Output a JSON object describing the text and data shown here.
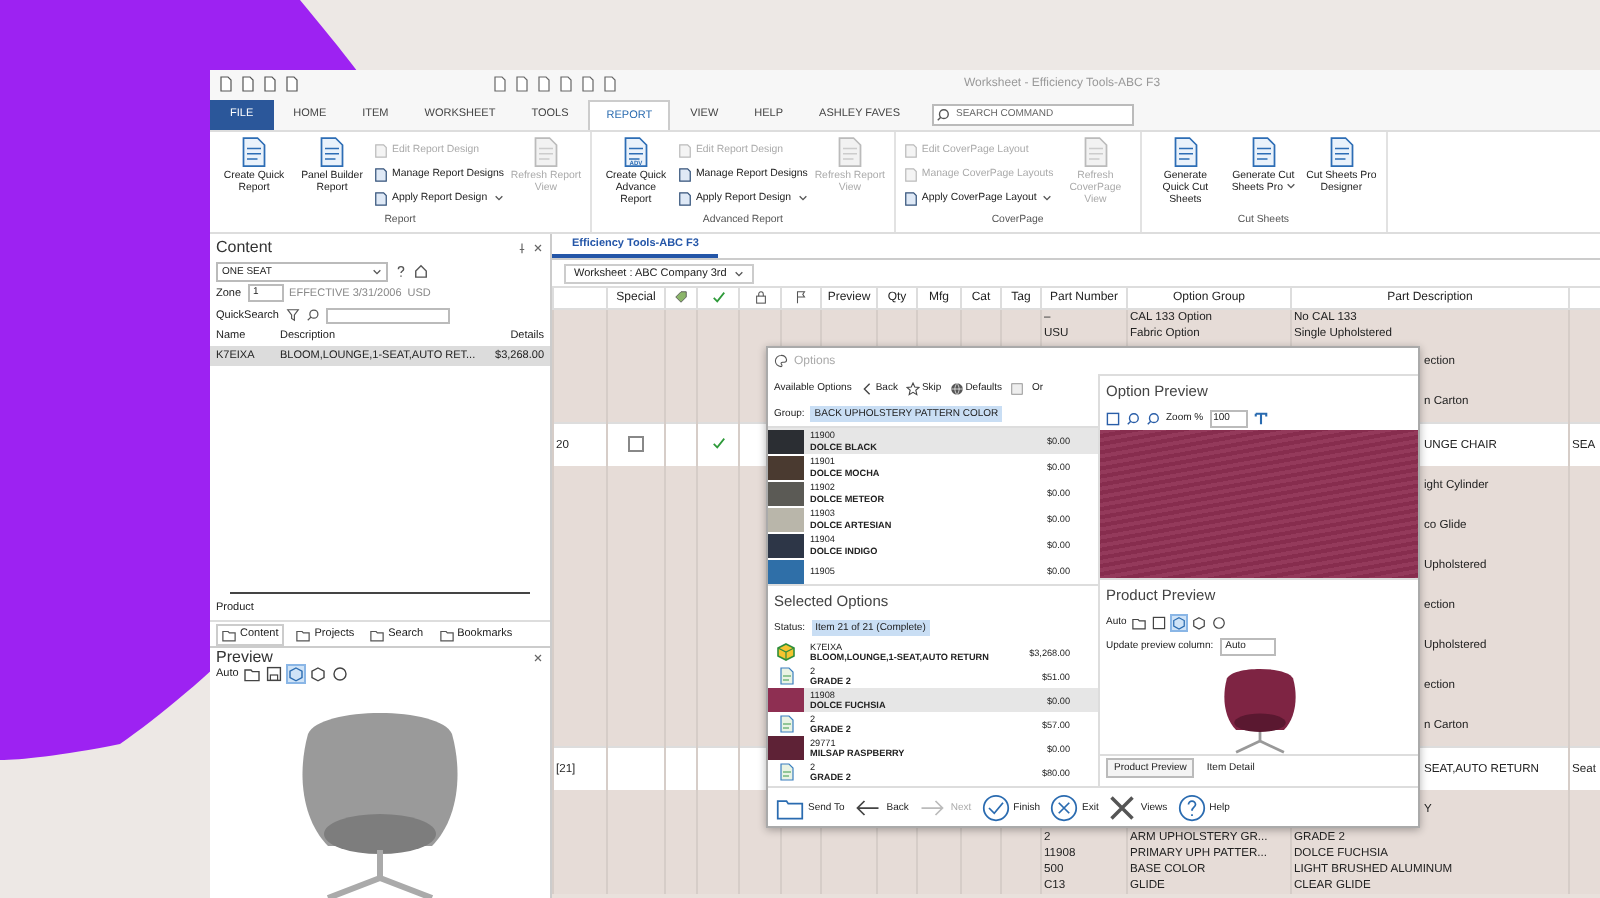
{
  "window": {
    "title": "Worksheet - Efficiency Tools-ABC F3"
  },
  "menu_tabs": [
    {
      "label": "FILE",
      "kind": "file",
      "selected": false
    },
    {
      "label": "HOME",
      "kind": "tab",
      "selected": false
    },
    {
      "label": "ITEM",
      "kind": "tab",
      "selected": false
    },
    {
      "label": "WORKSHEET",
      "kind": "tab",
      "selected": false
    },
    {
      "label": "TOOLS",
      "kind": "tab",
      "selected": false
    },
    {
      "label": "REPORT",
      "kind": "tab",
      "selected": true
    },
    {
      "label": "VIEW",
      "kind": "tab",
      "selected": false
    },
    {
      "label": "HELP",
      "kind": "tab",
      "selected": false
    },
    {
      "label": "ASHLEY FAVES",
      "kind": "tab",
      "selected": false
    }
  ],
  "search": {
    "placeholder": "SEARCH COMMAND"
  },
  "ribbon": {
    "groups": [
      {
        "label": "Report",
        "items": [
          {
            "kind": "large",
            "label": "Create Quick Report",
            "disabled": false
          },
          {
            "kind": "large",
            "label": "Panel Builder Report",
            "disabled": false
          },
          {
            "kind": "stack",
            "items": [
              {
                "label": "Edit Report Design",
                "disabled": true,
                "dropdown": false
              },
              {
                "label": "Manage Report Designs",
                "disabled": false,
                "dropdown": false
              },
              {
                "label": "Apply Report Design",
                "disabled": false,
                "dropdown": true
              }
            ]
          },
          {
            "kind": "large",
            "label": "Refresh Report View",
            "disabled": true
          }
        ]
      },
      {
        "label": "Advanced Report",
        "items": [
          {
            "kind": "large",
            "label": "Create Quick Advance Report",
            "icon_text": "ADV",
            "disabled": false
          },
          {
            "kind": "stack",
            "items": [
              {
                "label": "Edit Report Design",
                "disabled": true,
                "dropdown": false
              },
              {
                "label": "Manage Report Designs",
                "disabled": false,
                "dropdown": false
              },
              {
                "label": "Apply Report Design",
                "disabled": false,
                "dropdown": true
              }
            ]
          },
          {
            "kind": "large",
            "label": "Refresh Report View",
            "disabled": true
          }
        ]
      },
      {
        "label": "CoverPage",
        "items": [
          {
            "kind": "stack",
            "items": [
              {
                "label": "Edit CoverPage Layout",
                "disabled": true,
                "dropdown": false
              },
              {
                "label": "Manage CoverPage Layouts",
                "disabled": true,
                "dropdown": false
              },
              {
                "label": "Apply CoverPage Layout",
                "disabled": false,
                "dropdown": true
              }
            ]
          },
          {
            "kind": "large",
            "label": "Refresh CoverPage View",
            "disabled": true
          }
        ]
      },
      {
        "label": "Cut Sheets",
        "items": [
          {
            "kind": "large",
            "label": "Generate Quick Cut Sheets",
            "disabled": false
          },
          {
            "kind": "large",
            "label": "Generate Cut Sheets Pro",
            "disabled": false,
            "dropdown": true
          },
          {
            "kind": "large",
            "label": "Cut Sheets Pro Designer",
            "disabled": false
          }
        ]
      }
    ]
  },
  "content_panel": {
    "title": "Content",
    "catalog": "ONE SEAT",
    "zone_label": "Zone",
    "zone": "1",
    "effective": "EFFECTIVE 3/31/2006",
    "currency": "USD",
    "quicksearch_label": "QuickSearch",
    "columns": [
      "Name",
      "Description",
      "Details"
    ],
    "rows": [
      {
        "name": "K7EIXA",
        "description": "BLOOM,LOUNGE,1-SEAT,AUTO RET...",
        "details": "$3,268.00",
        "selected": true
      }
    ],
    "section_label": "Product",
    "tabs": [
      {
        "label": "Content",
        "selected": true
      },
      {
        "label": "Projects",
        "selected": false
      },
      {
        "label": "Search",
        "selected": false
      },
      {
        "label": "Bookmarks",
        "selected": false
      }
    ]
  },
  "preview_panel": {
    "title": "Preview",
    "mode": "Auto"
  },
  "document_tabs": [
    {
      "label": "Efficiency Tools-ABC F3",
      "selected": true
    }
  ],
  "worksheet_selector": {
    "value": "Worksheet : ABC Company 3rd"
  },
  "table": {
    "columns": [
      "Special",
      "Preview",
      "Qty",
      "Mfg",
      "Cat",
      "Tag",
      "Part Number",
      "Option Group",
      "Part Description"
    ],
    "rows": [
      {
        "kind": "detail",
        "part_number": "–",
        "option_group": "CAL 133 Option",
        "description": "No CAL 133"
      },
      {
        "kind": "detail",
        "part_number": "USU",
        "option_group": "Fabric Option",
        "description": "Single Upholstered"
      },
      {
        "kind": "detail",
        "description": "ection",
        "covered": true
      },
      {
        "kind": "detail",
        "description": "n Carton",
        "covered": true
      },
      {
        "kind": "item",
        "number": "20",
        "special": false,
        "checked": true,
        "description": "UNGE CHAIR",
        "covered": true,
        "column_15": "SEA"
      },
      {
        "kind": "detail",
        "description": "ight Cylinder",
        "covered": true
      },
      {
        "kind": "detail",
        "description": "co Glide",
        "covered": true
      },
      {
        "kind": "detail",
        "description": "Upholstered",
        "covered": true
      },
      {
        "kind": "detail",
        "description": "ection",
        "covered": true
      },
      {
        "kind": "detail",
        "description": "Upholstered",
        "covered": true
      },
      {
        "kind": "detail",
        "description": "ection",
        "covered": true
      },
      {
        "kind": "detail",
        "description": "n Carton",
        "covered": true
      },
      {
        "kind": "item",
        "number": "[21]",
        "description": "SEAT,AUTO RETURN",
        "covered": true,
        "column_15": "Seat"
      },
      {
        "kind": "detail",
        "description": "Y",
        "covered": true
      },
      {
        "kind": "detail",
        "part_number": "2",
        "option_group": "ARM UPHOLSTERY GR...",
        "description": "GRADE 2"
      },
      {
        "kind": "detail",
        "part_number": "11908",
        "option_group": "PRIMARY UPH PATTER...",
        "description": "DOLCE FUCHSIA"
      },
      {
        "kind": "detail",
        "part_number": "500",
        "option_group": "BASE COLOR",
        "description": "LIGHT BRUSHED ALUMINUM"
      },
      {
        "kind": "detail",
        "part_number": "C13",
        "option_group": "GLIDE",
        "description": "CLEAR GLIDE"
      }
    ]
  },
  "options_dialog": {
    "title": "Options",
    "available_options": {
      "title": "Available Options",
      "back": "Back",
      "skip": "Skip",
      "defaults": "Defaults",
      "more": "Or",
      "group_label": "Group:",
      "group": "BACK UPHOLSTERY PATTERN COLOR",
      "items": [
        {
          "code": "11900",
          "name": "DOLCE BLACK",
          "price": "$0.00",
          "color": "#2b2e33",
          "selected": true
        },
        {
          "code": "11901",
          "name": "DOLCE MOCHA",
          "price": "$0.00",
          "color": "#4a3a30",
          "selected": false
        },
        {
          "code": "11902",
          "name": "DOLCE METEOR",
          "price": "$0.00",
          "color": "#5b5a55",
          "selected": false
        },
        {
          "code": "11903",
          "name": "DOLCE ARTESIAN",
          "price": "$0.00",
          "color": "#b9b6aa",
          "selected": false
        },
        {
          "code": "11904",
          "name": "DOLCE INDIGO",
          "price": "$0.00",
          "color": "#2d3647",
          "selected": false
        },
        {
          "code": "11905",
          "price": "$0.00",
          "color": "#2f6fa8",
          "selected": false
        }
      ]
    },
    "option_preview": {
      "title": "Option Preview",
      "zoom_label": "Zoom %",
      "zoom": "100"
    },
    "selected_options": {
      "title": "Selected Options",
      "status_label": "Status:",
      "status": "Item 21 of 21 (Complete)",
      "items": [
        {
          "kind": "product",
          "code": "K7EIXA",
          "name": "BLOOM,LOUNGE,1-SEAT,AUTO RETURN",
          "price": "$3,268.00",
          "selected": false
        },
        {
          "kind": "grade",
          "code": "2",
          "name": "GRADE 2",
          "price": "$51.00",
          "selected": false
        },
        {
          "kind": "swatch",
          "code": "11908",
          "name": "DOLCE FUCHSIA",
          "price": "$0.00",
          "color": "#8e2f52",
          "selected": true
        },
        {
          "kind": "grade",
          "code": "2",
          "name": "GRADE 2",
          "price": "$57.00",
          "selected": false
        },
        {
          "kind": "swatch",
          "code": "29771",
          "name": "MILSAP RASPBERRY",
          "price": "$0.00",
          "color": "#5e2236",
          "selected": false
        },
        {
          "kind": "grade",
          "code": "2",
          "name": "GRADE 2",
          "price": "$80.00",
          "selected": false
        }
      ]
    },
    "product_preview": {
      "title": "Product Preview",
      "mode": "Auto",
      "update_label": "Update preview column:",
      "update_value": "Auto",
      "tabs": [
        {
          "label": "Product Preview",
          "selected": true
        },
        {
          "label": "Item Detail",
          "selected": false
        }
      ]
    },
    "buttons": [
      {
        "kind": "send",
        "label": "Send To",
        "disabled": false
      },
      {
        "kind": "back",
        "label": "Back",
        "disabled": false
      },
      {
        "kind": "next",
        "label": "Next",
        "disabled": true
      },
      {
        "kind": "finish",
        "label": "Finish",
        "disabled": false
      },
      {
        "kind": "exit",
        "label": "Exit",
        "disabled": false
      },
      {
        "kind": "views",
        "label": "Views",
        "disabled": false
      },
      {
        "kind": "help",
        "label": "Help",
        "disabled": false
      }
    ]
  }
}
